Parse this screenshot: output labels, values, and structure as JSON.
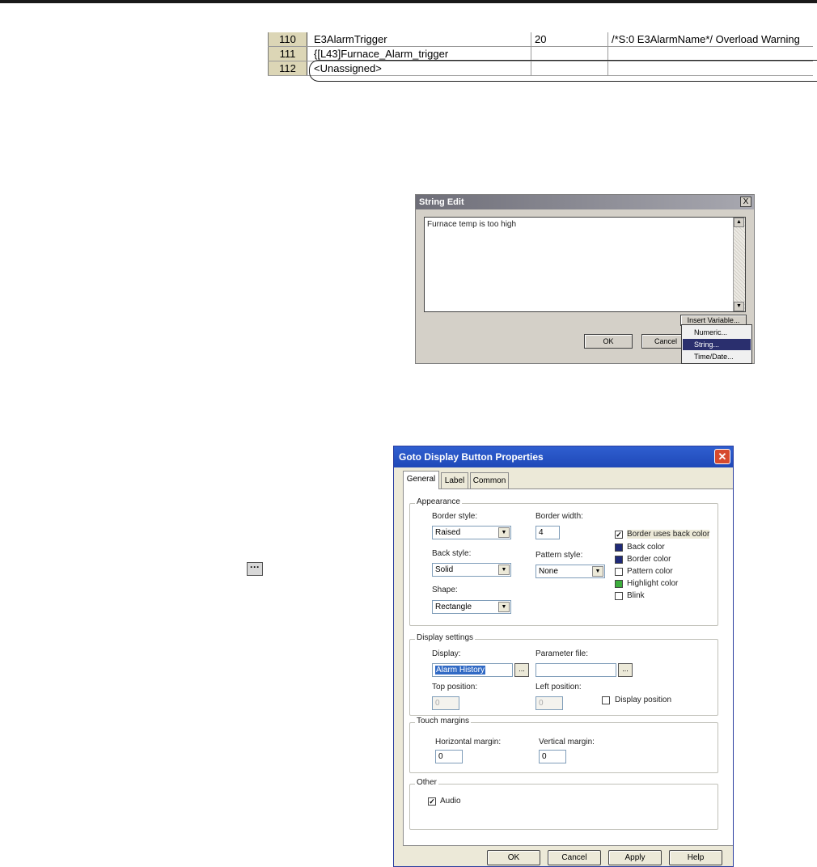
{
  "grid": {
    "rows": [
      {
        "num": "110",
        "name": "E3AlarmTrigger",
        "value": "20",
        "message": "/*S:0 E3AlarmName*/ Overload Warning"
      },
      {
        "num": "111",
        "name": "{[L43]Furnace_Alarm_trigger",
        "value": "",
        "message": ""
      },
      {
        "num": "112",
        "name": "<Unassigned>",
        "value": "",
        "message": ""
      }
    ]
  },
  "string_edit": {
    "title": "String Edit",
    "close": "X",
    "text": "Furnace temp is too high",
    "insert_variable": "Insert Variable...",
    "ok": "OK",
    "cancel": "Cancel",
    "menu": [
      "Numeric...",
      "String...",
      "Time/Date..."
    ],
    "menu_selected": "String..."
  },
  "ellipsis_icon_glyph": "···",
  "goto": {
    "title": "Goto Display Button Properties",
    "close": "✕",
    "tabs": [
      "General",
      "Label",
      "Common"
    ],
    "active_tab": "General",
    "appearance": {
      "title": "Appearance",
      "border_style_label": "Border style:",
      "border_style": "Raised",
      "border_width_label": "Border width:",
      "border_width": "4",
      "back_style_label": "Back style:",
      "back_style": "Solid",
      "pattern_style_label": "Pattern style:",
      "pattern_style": "None",
      "shape_label": "Shape:",
      "shape": "Rectangle",
      "border_uses_back": "Border uses back color",
      "border_uses_back_checked": true,
      "colors": [
        {
          "label": "Back color",
          "color": "#1f2a78"
        },
        {
          "label": "Border color",
          "color": "#1f2a78"
        },
        {
          "label": "Pattern color",
          "color": "#ffffff"
        },
        {
          "label": "Highlight color",
          "color": "#3cae3c"
        }
      ],
      "blink": "Blink"
    },
    "display_settings": {
      "title": "Display settings",
      "display_label": "Display:",
      "display": "Alarm History",
      "parameter_label": "Parameter file:",
      "parameter": "",
      "top_label": "Top position:",
      "top": "0",
      "left_label": "Left position:",
      "left": "0",
      "display_position": "Display position"
    },
    "touch_margins": {
      "title": "Touch margins",
      "horizontal_label": "Horizontal  margin:",
      "horizontal": "0",
      "vertical_label": "Vertical margin:",
      "vertical": "0"
    },
    "other": {
      "title": "Other",
      "audio": "Audio",
      "audio_checked": true
    },
    "buttons": {
      "ok": "OK",
      "cancel": "Cancel",
      "apply": "Apply",
      "help": "Help"
    }
  }
}
